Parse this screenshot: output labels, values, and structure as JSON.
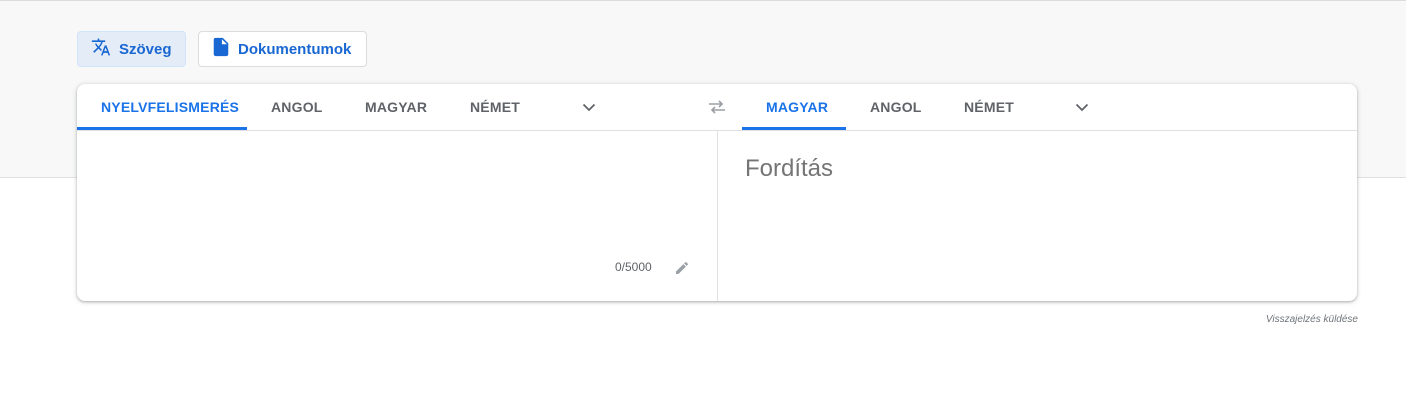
{
  "modes": {
    "text_label": "Szöveg",
    "documents_label": "Dokumentumok"
  },
  "source_languages": {
    "detect": "NYELVFELISMERÉS",
    "lang1": "ANGOL",
    "lang2": "MAGYAR",
    "lang3": "NÉMET"
  },
  "target_languages": {
    "lang1": "MAGYAR",
    "lang2": "ANGOL",
    "lang3": "NÉMET"
  },
  "source": {
    "value": "",
    "char_count": "0/5000"
  },
  "target": {
    "placeholder": "Fordítás"
  },
  "feedback_link": "Visszajelzés küldése",
  "icons": {
    "text_mode": "translate-icon",
    "documents_mode": "document-icon",
    "more_languages": "chevron-down-icon",
    "swap": "swap-languages-icon",
    "edit": "pencil-icon"
  },
  "colors": {
    "accent": "#1a73e8",
    "active_mode_bg": "#e4ecf7",
    "band_bg": "#f8f8f8"
  }
}
